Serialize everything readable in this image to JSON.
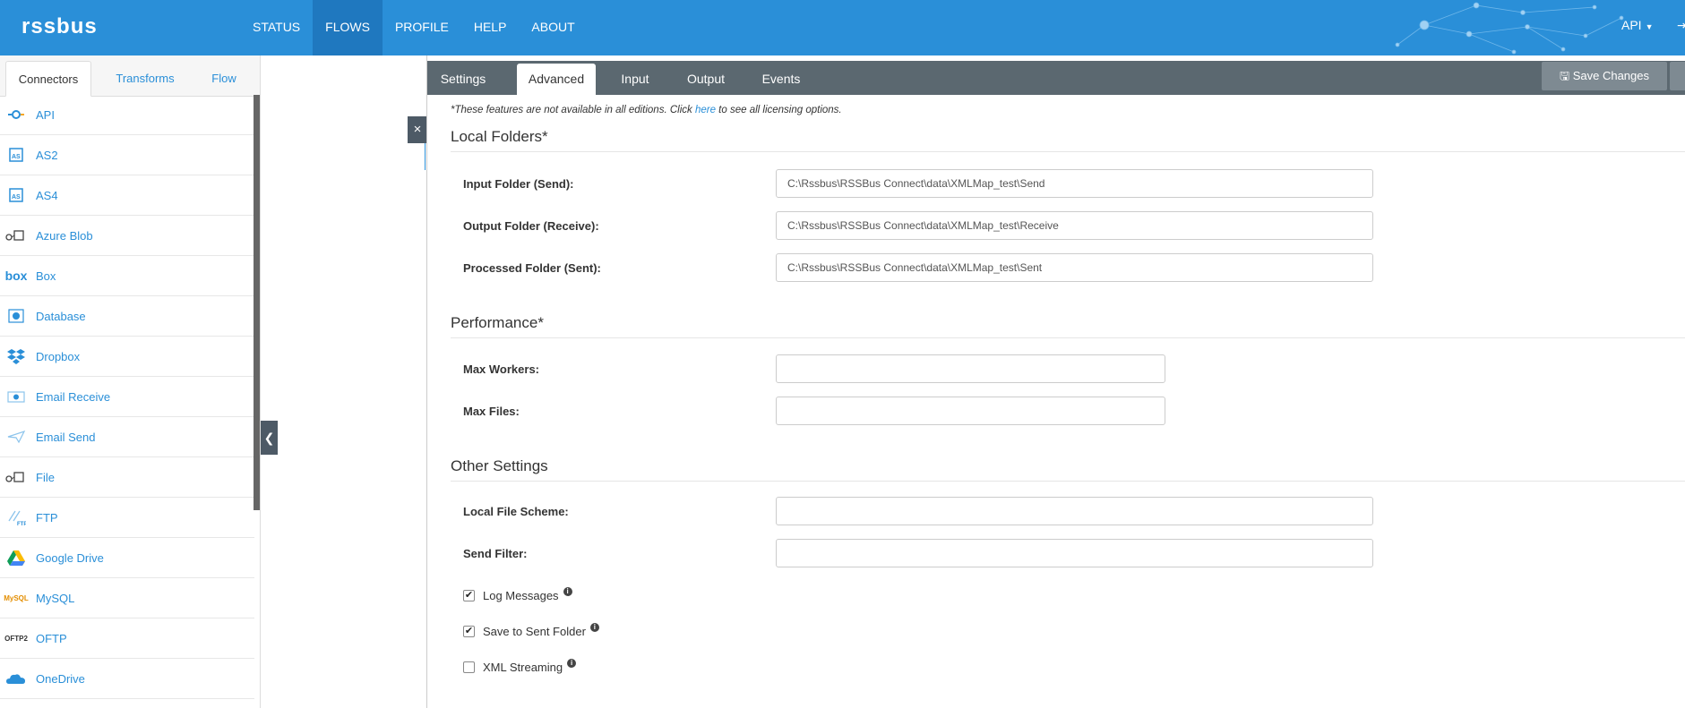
{
  "brand": {
    "logo": "rssbus",
    "accent": "#2a8fd8"
  },
  "nav": {
    "items": [
      "STATUS",
      "FLOWS",
      "PROFILE",
      "HELP",
      "ABOUT"
    ],
    "active": "FLOWS",
    "api_menu": "API"
  },
  "left_panel": {
    "tabs": [
      "Connectors",
      "Transforms",
      "Flow"
    ],
    "active_tab": "Connectors",
    "connectors": [
      {
        "label": "API",
        "icon": "api-icon"
      },
      {
        "label": "AS2",
        "icon": "as2-icon"
      },
      {
        "label": "AS4",
        "icon": "as4-icon"
      },
      {
        "label": "Azure Blob",
        "icon": "azure-blob-icon"
      },
      {
        "label": "Box",
        "icon": "box-icon"
      },
      {
        "label": "Database",
        "icon": "database-icon"
      },
      {
        "label": "Dropbox",
        "icon": "dropbox-icon"
      },
      {
        "label": "Email Receive",
        "icon": "email-receive-icon"
      },
      {
        "label": "Email Send",
        "icon": "email-send-icon"
      },
      {
        "label": "File",
        "icon": "file-icon"
      },
      {
        "label": "FTP",
        "icon": "ftp-icon"
      },
      {
        "label": "Google Drive",
        "icon": "google-drive-icon"
      },
      {
        "label": "MySQL",
        "icon": "mysql-icon"
      },
      {
        "label": "OFTP",
        "icon": "oftp-icon"
      },
      {
        "label": "OneDrive",
        "icon": "onedrive-icon"
      }
    ]
  },
  "main": {
    "tabs": [
      "Settings",
      "Advanced",
      "Input",
      "Output",
      "Events"
    ],
    "active_tab": "Advanced",
    "save_label": "Save Changes",
    "notice_pre": "*These features are not available in all editions. Click ",
    "notice_link": "here",
    "notice_post": " to see all licensing options.",
    "local_folders": {
      "title": "Local Folders*",
      "fields": [
        {
          "label": "Input Folder (Send):",
          "value": "C:\\Rssbus\\RSSBus Connect\\data\\XMLMap_test\\Send"
        },
        {
          "label": "Output Folder (Receive):",
          "value": "C:\\Rssbus\\RSSBus Connect\\data\\XMLMap_test\\Receive"
        },
        {
          "label": "Processed Folder (Sent):",
          "value": "C:\\Rssbus\\RSSBus Connect\\data\\XMLMap_test\\Sent"
        }
      ]
    },
    "performance": {
      "title": "Performance*",
      "fields": [
        {
          "label": "Max Workers:",
          "value": ""
        },
        {
          "label": "Max Files:",
          "value": ""
        }
      ]
    },
    "other": {
      "title": "Other Settings",
      "fields": [
        {
          "label": "Local File Scheme:",
          "value": ""
        },
        {
          "label": "Send Filter:",
          "value": ""
        }
      ],
      "checks": [
        {
          "label": "Log Messages",
          "checked": true
        },
        {
          "label": "Save to Sent Folder",
          "checked": true
        },
        {
          "label": "XML Streaming",
          "checked": false
        }
      ]
    }
  }
}
